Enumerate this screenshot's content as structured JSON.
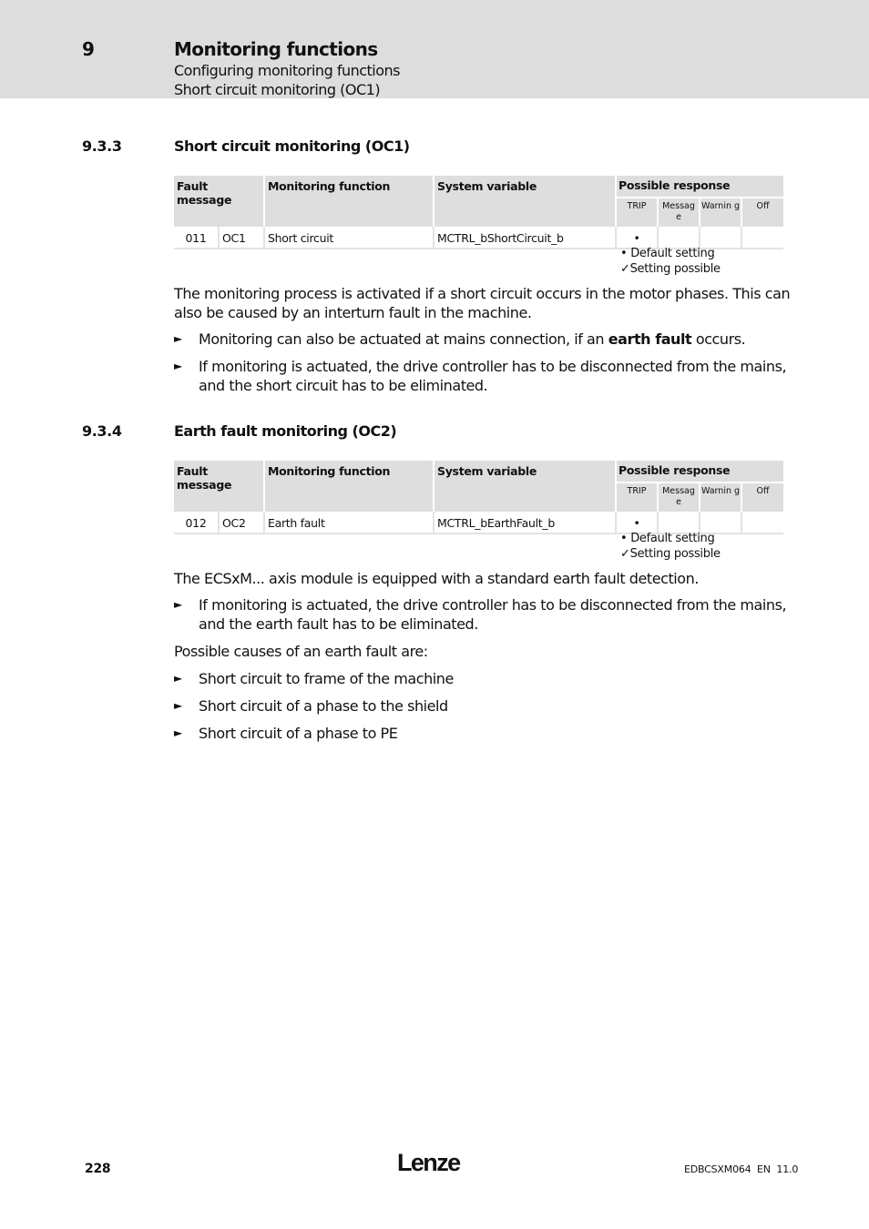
{
  "header": {
    "chapter_number": "9",
    "chapter_title": "Monitoring functions",
    "sub_line1": "Configuring monitoring functions",
    "sub_line2": "Short circuit monitoring (OC1)"
  },
  "table_headers": {
    "fault_message": "Fault message",
    "monitoring_function": "Monitoring function",
    "system_variable": "System variable",
    "possible_response": "Possible response",
    "responses": [
      "TRIP",
      "Messag e",
      "Warnin g",
      "Off"
    ]
  },
  "legend": {
    "default": "• Default setting",
    "possible": "✓Setting possible"
  },
  "sections": [
    {
      "number": "9.3.3",
      "title": "Short circuit monitoring (OC1)",
      "row": {
        "code": "011",
        "id": "OC1",
        "function": "Short circuit",
        "variable": "MCTRL_bShortCircuit_b",
        "trip": "•",
        "message": "",
        "warning": "",
        "off": ""
      },
      "paragraph": "The monitoring process is activated if a short circuit occurs in the motor phases. This can also be caused by an interturn fault in the machine.",
      "bullets": [
        {
          "before": "Monitoring can also be actuated at mains connection, if an ",
          "bold": "earth fault",
          "after": " occurs."
        },
        {
          "before": "If monitoring is actuated, the drive controller has to be disconnected from the mains, and the short circuit has to be eliminated.",
          "bold": "",
          "after": ""
        }
      ]
    },
    {
      "number": "9.3.4",
      "title": "Earth fault monitoring (OC2)",
      "row": {
        "code": "012",
        "id": "OC2",
        "function": "Earth fault",
        "variable": "MCTRL_bEarthFault_b",
        "trip": "•",
        "message": "",
        "warning": "",
        "off": ""
      },
      "paragraph": "The ECSxM... axis module is equipped with a standard earth fault detection.",
      "bullets": [
        {
          "before": "If monitoring is actuated, the drive controller has to be disconnected from the mains, and the earth fault has to be eliminated.",
          "bold": "",
          "after": ""
        }
      ],
      "causes_intro": "Possible causes of an earth fault are:",
      "causes": [
        "Short circuit to frame of the machine",
        "Short circuit of a phase to the shield",
        "Short circuit of a phase to PE"
      ]
    }
  ],
  "bullet_glyph": "►",
  "footer": {
    "page_number": "228",
    "logo": "Lenze",
    "doc_id": "EDBCSXM064  EN  11.0"
  }
}
